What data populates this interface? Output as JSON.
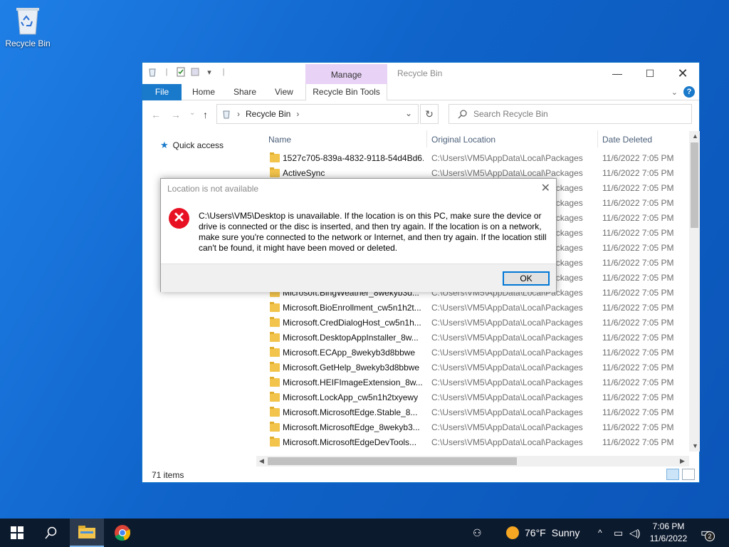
{
  "desktop": {
    "recycle_bin_label": "Recycle Bin"
  },
  "explorer": {
    "title": "Recycle Bin",
    "manage_label": "Manage",
    "tabs": {
      "file": "File",
      "home": "Home",
      "share": "Share",
      "view": "View",
      "tools": "Recycle Bin Tools"
    },
    "address": {
      "crumb": "Recycle Bin"
    },
    "search_placeholder": "Search Recycle Bin",
    "nav": {
      "quick_access": "Quick access"
    },
    "columns": {
      "name": "Name",
      "location": "Original Location",
      "date": "Date Deleted"
    },
    "rows": [
      {
        "name": "1527c705-839a-4832-9118-54d4Bd6...",
        "location": "C:\\Users\\VM5\\AppData\\Local\\Packages",
        "date": "11/6/2022 7:05 PM"
      },
      {
        "name": "ActiveSync",
        "location": "C:\\Users\\VM5\\AppData\\Local\\Packages",
        "date": "11/6/2022 7:05 PM"
      },
      {
        "name": "",
        "location": "C:\\Users\\VM5\\AppData\\Local\\Packages",
        "date": "11/6/2022 7:05 PM"
      },
      {
        "name": "",
        "location": "C:\\Users\\VM5\\AppData\\Local\\Packages",
        "date": "11/6/2022 7:05 PM"
      },
      {
        "name": "",
        "location": "C:\\Users\\VM5\\AppData\\Local\\Packages",
        "date": "11/6/2022 7:05 PM"
      },
      {
        "name": "",
        "location": "C:\\Users\\VM5\\AppData\\Local\\Packages",
        "date": "11/6/2022 7:05 PM"
      },
      {
        "name": "",
        "location": "C:\\Users\\VM5\\AppData\\Local\\Packages",
        "date": "11/6/2022 7:05 PM"
      },
      {
        "name": "",
        "location": "C:\\Users\\VM5\\AppData\\Local\\Packages",
        "date": "11/6/2022 7:05 PM"
      },
      {
        "name": "",
        "location": "C:\\Users\\VM5\\AppData\\Local\\Packages",
        "date": "11/6/2022 7:05 PM"
      },
      {
        "name": "Microsoft.BingWeather_8wekyb3d...",
        "location": "C:\\Users\\VM5\\AppData\\Local\\Packages",
        "date": "11/6/2022 7:05 PM"
      },
      {
        "name": "Microsoft.BioEnrollment_cw5n1h2t...",
        "location": "C:\\Users\\VM5\\AppData\\Local\\Packages",
        "date": "11/6/2022 7:05 PM"
      },
      {
        "name": "Microsoft.CredDialogHost_cw5n1h...",
        "location": "C:\\Users\\VM5\\AppData\\Local\\Packages",
        "date": "11/6/2022 7:05 PM"
      },
      {
        "name": "Microsoft.DesktopAppInstaller_8w...",
        "location": "C:\\Users\\VM5\\AppData\\Local\\Packages",
        "date": "11/6/2022 7:05 PM"
      },
      {
        "name": "Microsoft.ECApp_8wekyb3d8bbwe",
        "location": "C:\\Users\\VM5\\AppData\\Local\\Packages",
        "date": "11/6/2022 7:05 PM"
      },
      {
        "name": "Microsoft.GetHelp_8wekyb3d8bbwe",
        "location": "C:\\Users\\VM5\\AppData\\Local\\Packages",
        "date": "11/6/2022 7:05 PM"
      },
      {
        "name": "Microsoft.HEIFImageExtension_8w...",
        "location": "C:\\Users\\VM5\\AppData\\Local\\Packages",
        "date": "11/6/2022 7:05 PM"
      },
      {
        "name": "Microsoft.LockApp_cw5n1h2txyewy",
        "location": "C:\\Users\\VM5\\AppData\\Local\\Packages",
        "date": "11/6/2022 7:05 PM"
      },
      {
        "name": "Microsoft.MicrosoftEdge.Stable_8...",
        "location": "C:\\Users\\VM5\\AppData\\Local\\Packages",
        "date": "11/6/2022 7:05 PM"
      },
      {
        "name": "Microsoft.MicrosoftEdge_8wekyb3...",
        "location": "C:\\Users\\VM5\\AppData\\Local\\Packages",
        "date": "11/6/2022 7:05 PM"
      },
      {
        "name": "Microsoft.MicrosoftEdgeDevTools...",
        "location": "C:\\Users\\VM5\\AppData\\Local\\Packages",
        "date": "11/6/2022 7:05 PM"
      }
    ],
    "status_count": "71 items"
  },
  "dialog": {
    "title": "Location is not available",
    "message": "C:\\Users\\VM5\\Desktop is unavailable. If the location is on this PC, make sure the device or drive is connected or the disc is inserted, and then try again. If the location is on a network, make sure you're connected to the network or Internet, and then try again. If the location still can't be found, it might have been moved or deleted.",
    "ok_label": "OK"
  },
  "taskbar": {
    "weather_temp": "76°F",
    "weather_desc": "Sunny",
    "time": "7:06 PM",
    "date": "11/6/2022",
    "notification_count": "2"
  },
  "colors": {
    "accent": "#1979ca",
    "manage_tab": "#e8d2f6",
    "error": "#e81123",
    "taskbar": "#0c1a2e"
  },
  "icons": [
    "recycle-bin-icon",
    "folder-icon",
    "search-icon",
    "refresh-icon",
    "up-arrow-icon",
    "back-arrow-icon",
    "forward-arrow-icon",
    "error-icon",
    "windows-start-icon",
    "file-explorer-icon",
    "chrome-icon",
    "people-icon",
    "weather-sun-icon",
    "network-icon",
    "volume-icon",
    "notification-icon",
    "help-icon",
    "close-icon",
    "minimize-icon",
    "maximize-icon"
  ]
}
